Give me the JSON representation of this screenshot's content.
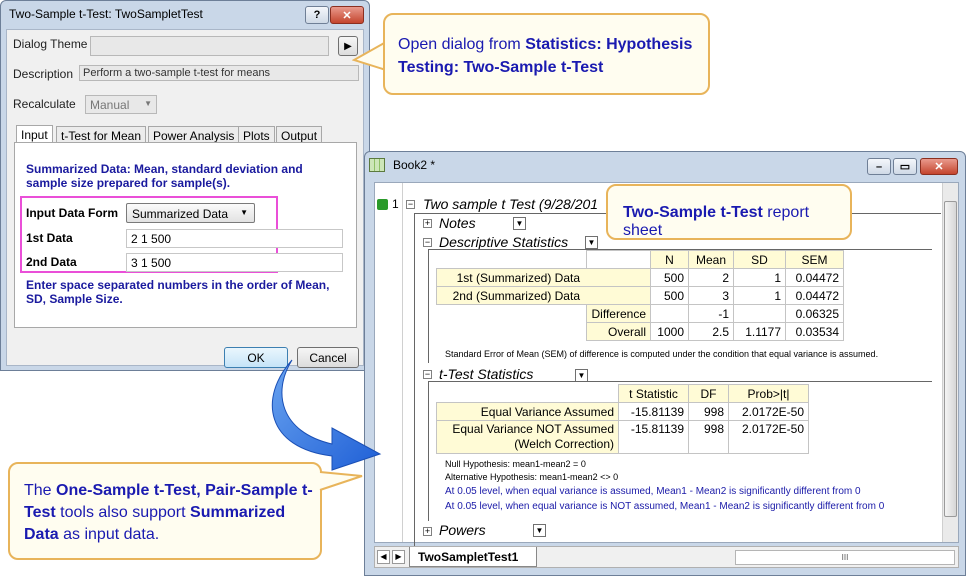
{
  "dialog": {
    "title": "Two-Sample t-Test: TwoSampletTest",
    "help_label": "?",
    "close_label": "✕",
    "dialog_theme_label": "Dialog Theme",
    "dialog_theme_value": "",
    "theme_arrow": "▶",
    "description_label": "Description",
    "description_value": "Perform a two-sample t-test for means",
    "recalculate_label": "Recalculate",
    "recalculate_value": "Manual",
    "tabs": [
      "Input",
      "t-Test for Mean",
      "Power Analysis",
      "Plots",
      "Output"
    ],
    "summary_text": "Summarized Data: Mean, standard deviation and sample size prepared for sample(s).",
    "input_form_label": "Input Data Form",
    "input_form_value": "Summarized Data",
    "first_data_label": "1st Data",
    "first_data_value": "2 1 500",
    "second_data_label": "2nd Data",
    "second_data_value": "3 1 500",
    "hint_text": "Enter space separated numbers in the order of Mean, SD, Sample Size.",
    "ok_label": "OK",
    "cancel_label": "Cancel"
  },
  "callouts": {
    "open_dialog_plain": "Open dialog from ",
    "open_dialog_bold": "Statistics: Hypothesis Testing: Two-Sample t-Test",
    "report_bold": "Two-Sample t-Test",
    "report_plain": " report sheet",
    "bottom_1": "The ",
    "bottom_2": "One-Sample t-Test, Pair-Sample t-Test",
    "bottom_3": " tools also support ",
    "bottom_4": "Summarized Data",
    "bottom_5": " as input data."
  },
  "book": {
    "title": "Book2 *",
    "row_number": "1",
    "report_title": "Two sample t Test (9/28/201",
    "sections": {
      "notes": "Notes",
      "descriptive": "Descriptive Statistics",
      "ttest": "t-Test Statistics",
      "powers": "Powers"
    },
    "desc_headers": [
      "N",
      "Mean",
      "SD",
      "SEM"
    ],
    "desc_rows": [
      {
        "label": "1st (Summarized) Data",
        "n": "500",
        "mean": "2",
        "sd": "1",
        "sem": "0.04472"
      },
      {
        "label": "2nd (Summarized) Data",
        "n": "500",
        "mean": "3",
        "sd": "1",
        "sem": "0.04472"
      },
      {
        "label": "Difference",
        "n": "",
        "mean": "-1",
        "sd": "",
        "sem": "0.06325"
      },
      {
        "label": "Overall",
        "n": "1000",
        "mean": "2.5",
        "sd": "1.1177",
        "sem": "0.03534"
      }
    ],
    "desc_note": "Standard Error of Mean (SEM) of difference is computed under the condition that equal variance is assumed.",
    "t_headers": [
      "t Statistic",
      "DF",
      "Prob>|t|"
    ],
    "t_rows": [
      {
        "label": "Equal Variance Assumed",
        "t": "-15.81139",
        "df": "998",
        "p": "2.0172E-50"
      },
      {
        "label1": "Equal Variance NOT Assumed",
        "label2": "(Welch Correction)",
        "t": "-15.81139",
        "df": "998",
        "p": "2.0172E-50"
      }
    ],
    "null_hyp": "Null Hypothesis: mean1-mean2 = 0",
    "alt_hyp": "Alternative Hypothesis: mean1-mean2 <> 0",
    "conclusion_1": "At 0.05 level, when equal variance is assumed, Mean1 - Mean2 is significantly different from 0",
    "conclusion_2": "At 0.05 level, when equal variance is NOT assumed, Mean1 - Mean2 is significantly different from 0",
    "sheet_tab": "TwoSampletTest1",
    "scroll_mark": "III"
  },
  "colors": {
    "highlight_box": "#ea4fd8",
    "callout_border": "#e8b45a",
    "arrow": "#1f5fd6",
    "label_blue": "#1a1a9e"
  }
}
